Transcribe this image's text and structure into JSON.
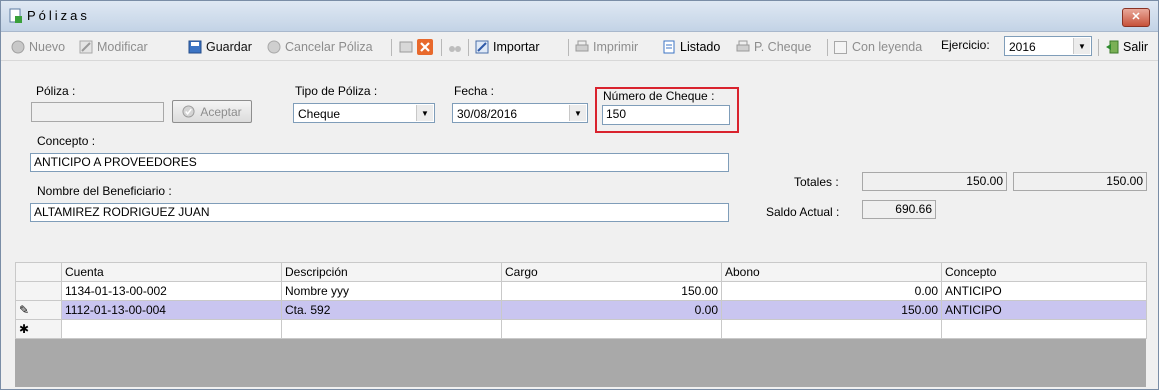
{
  "window": {
    "title": "Pólizas",
    "close_label": "✕"
  },
  "toolbar": {
    "nuevo": "Nuevo",
    "modificar": "Modificar",
    "guardar": "Guardar",
    "cancelar": "Cancelar Póliza",
    "importar": "Importar",
    "imprimir": "Imprimir",
    "listado": "Listado",
    "pcheque": "P. Cheque",
    "con_leyenda": "Con leyenda",
    "ejercicio_label": "Ejercicio:",
    "ejercicio_value": "2016",
    "salir": "Salir"
  },
  "form": {
    "poliza_label": "Póliza :",
    "poliza_value": "",
    "aceptar_label": "Aceptar",
    "tipo_label": "Tipo de Póliza :",
    "tipo_value": "Cheque",
    "fecha_label": "Fecha :",
    "fecha_value": "30/08/2016",
    "cheque_label": "Número de Cheque :",
    "cheque_value": "150",
    "concepto_label": "Concepto :",
    "concepto_value": "ANTICIPO A PROVEEDORES",
    "beneficiario_label": "Nombre del Beneficiario :",
    "beneficiario_value": "ALTAMIREZ RODRIGUEZ JUAN",
    "totales_label": "Totales :",
    "total_cargo": "150.00",
    "total_abono": "150.00",
    "saldo_label": "Saldo Actual :",
    "saldo_value": "690.66"
  },
  "grid": {
    "headers": [
      "Cuenta",
      "Descripción",
      "Cargo",
      "Abono",
      "Concepto"
    ],
    "rows": [
      {
        "marker": "",
        "cuenta": "1134-01-13-00-002",
        "descripcion": "Nombre yyy",
        "cargo": "150.00",
        "abono": "0.00",
        "concepto": "ANTICIPO"
      },
      {
        "marker": "✎",
        "cuenta": "1112-01-13-00-004",
        "descripcion": "Cta. 592",
        "cargo": "0.00",
        "abono": "150.00",
        "concepto": "ANTICIPO"
      }
    ],
    "new_row_marker": "✱"
  },
  "colors": {
    "highlight": "#d9232e",
    "selected_row": "#c9c5f0"
  }
}
